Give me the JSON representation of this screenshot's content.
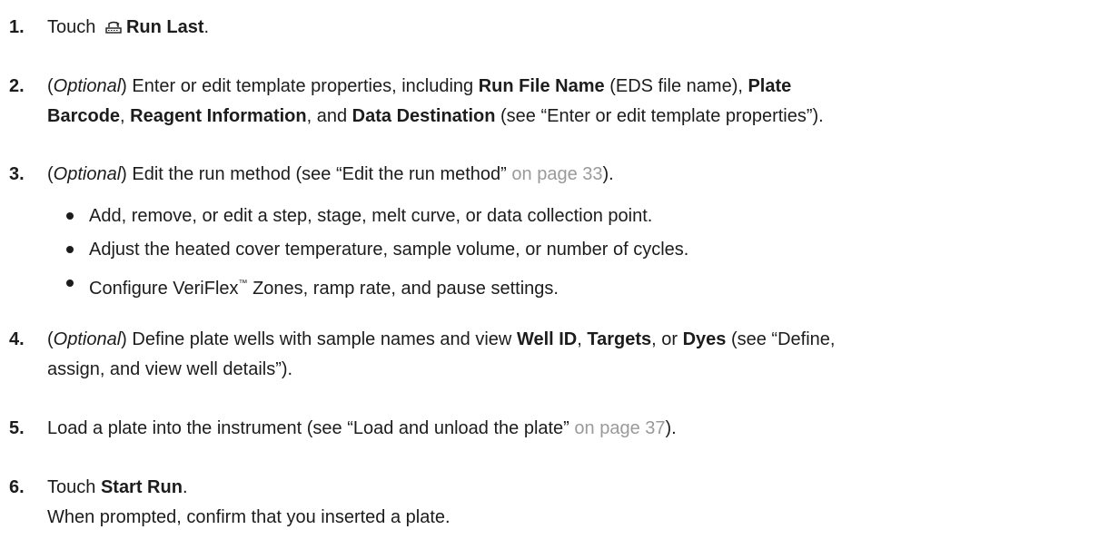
{
  "steps": [
    {
      "num": "1.",
      "prefix": "Touch",
      "icon": "run-last-icon",
      "bold": "Run Last",
      "suffix": "."
    },
    {
      "num": "2.",
      "optional": "Optional",
      "text_a": "Enter or edit template properties, including ",
      "bold_a": "Run File Name",
      "text_b": " (EDS file name), ",
      "bold_b": "Plate",
      "bold_c": "Barcode",
      "text_c": ", ",
      "bold_d": "Reagent Information",
      "text_d": ", and ",
      "bold_e": "Data Destination",
      "text_e": " (see “Enter or edit template properties”)."
    },
    {
      "num": "3.",
      "optional": "Optional",
      "text_a": "Edit the run method (see “Edit the run method”",
      "link": " on page 33",
      "text_b": ").",
      "bullets": [
        "Add, remove, or edit a step, stage, melt curve, or data collection point.",
        "Adjust the heated cover temperature, sample volume, or number of cycles."
      ],
      "bullet3_a": "Configure VeriFlex",
      "bullet3_tm": "™",
      "bullet3_b": " Zones, ramp rate, and pause settings."
    },
    {
      "num": "4.",
      "optional": "Optional",
      "text_a": "Define plate wells with sample names and view ",
      "bold_a": "Well ID",
      "text_b": ", ",
      "bold_b": "Targets",
      "text_c": ", or ",
      "bold_c": "Dyes",
      "text_d": " (see “Define,",
      "line2": "assign, and view well details”)."
    },
    {
      "num": "5.",
      "text_a": "Load a plate into the instrument (see “Load and unload the plate”",
      "link": " on page 37",
      "text_b": ")."
    },
    {
      "num": "6.",
      "prefix": "Touch ",
      "bold": "Start Run",
      "suffix": ".",
      "line2": "When prompted, confirm that you inserted a plate."
    }
  ]
}
